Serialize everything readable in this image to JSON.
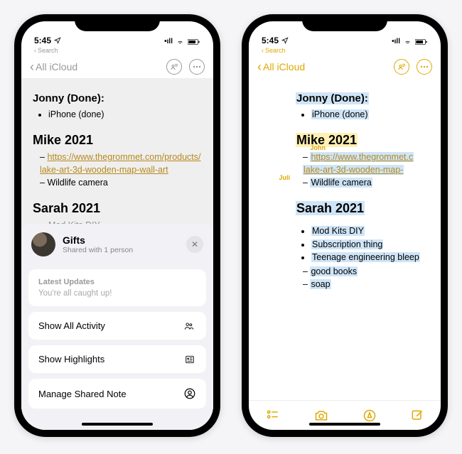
{
  "status": {
    "time": "5:45",
    "search_label": "Search"
  },
  "nav": {
    "back_label": "All iCloud"
  },
  "left": {
    "section1": {
      "title": "Jonny (Done):",
      "items": [
        "iPhone (done)"
      ]
    },
    "section2": {
      "title": "Mike 2021",
      "link": "https://www.thegrommet.com/products/lake-art-3d-wooden-map-wall-art",
      "item2": "Wildlife camera"
    },
    "section3": {
      "title": "Sarah 2021",
      "partial": "Mod Kits DIY"
    },
    "sheet": {
      "title": "Gifts",
      "subtitle": "Shared with 1 person",
      "latest_label": "Latest Updates",
      "latest_msg": "You're all caught up!",
      "opt1": "Show All Activity",
      "opt2": "Show Highlights",
      "opt3": "Manage Shared Note"
    }
  },
  "right": {
    "attrib1": "John",
    "attrib2": "Juli",
    "section1": {
      "title": "Jonny (Done):",
      "items": [
        "iPhone (done)"
      ]
    },
    "section2": {
      "title": "Mike 2021",
      "link_l1": "https://www.thegrommet.c",
      "link_l2": "lake-art-3d-wooden-map-",
      "item2": "Wildlife camera"
    },
    "section3": {
      "title": "Sarah 2021",
      "items": [
        "Mod Kits DIY",
        "Subscription thing",
        "Teenage engineering bleep"
      ],
      "dash_items": [
        "good books",
        "soap"
      ]
    }
  }
}
